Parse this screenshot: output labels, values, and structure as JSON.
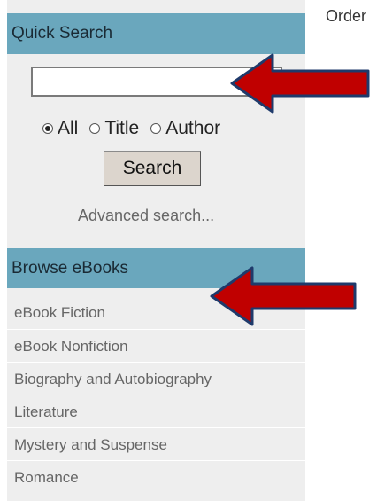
{
  "header_right": {
    "order_text": "Order"
  },
  "quick_search": {
    "title": "Quick Search",
    "input_value": "",
    "radios": [
      {
        "label": "All",
        "checked": true
      },
      {
        "label": "Title",
        "checked": false
      },
      {
        "label": "Author",
        "checked": false
      }
    ],
    "search_button": "Search",
    "advanced_link": "Advanced search..."
  },
  "browse": {
    "title": "Browse eBooks",
    "items": [
      "eBook Fiction",
      "eBook Nonfiction",
      "Biography and Autobiography",
      "Literature",
      "Mystery and Suspense",
      "Romance"
    ]
  },
  "annotations": {
    "arrow_color": "#c00000",
    "arrow_outline": "#1f3a6b"
  }
}
